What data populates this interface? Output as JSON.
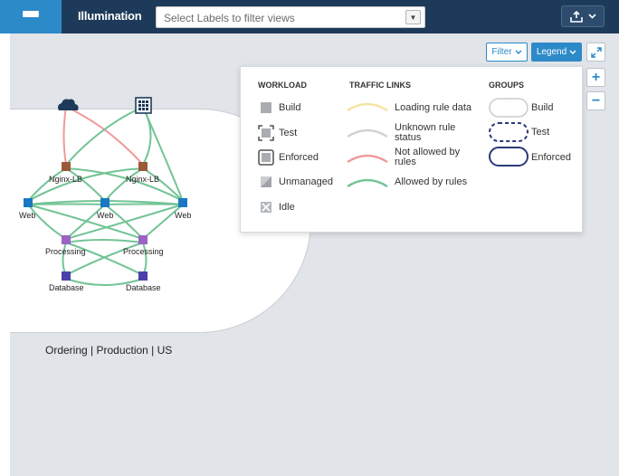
{
  "topbar": {
    "title": "Illumination",
    "label_filter_placeholder": "Select Labels to filter views",
    "menu_icon": "hamburger-icon",
    "export_icon": "upload-icon"
  },
  "toolbar": {
    "filter_label": "Filter",
    "legend_label": "Legend",
    "zoom_in": "+",
    "zoom_out": "−"
  },
  "colors": {
    "topbar": "#1e3a5a",
    "accent": "#2d8ac9",
    "canvas": "#e1e4e8",
    "allowed": "#72c496",
    "not_allowed": "#ef9a9a",
    "loading": "#f7e4a0",
    "unknown": "#cfd3d6",
    "lb": "#9a5a3a",
    "web": "#1a78c2",
    "processing": "#9b64c4",
    "database": "#4c3fa8"
  },
  "graph": {
    "group_label": "Ordering | Production | US",
    "nodes": [
      {
        "id": "cloud",
        "label": ""
      },
      {
        "id": "datacenter",
        "label": ""
      },
      {
        "id": "lb1",
        "label": "Nginx-LB"
      },
      {
        "id": "lb2",
        "label": "Nginx-LB"
      },
      {
        "id": "web1",
        "label": "Web"
      },
      {
        "id": "web2",
        "label": "Web"
      },
      {
        "id": "web3",
        "label": "Web"
      },
      {
        "id": "proc1",
        "label": "Processing"
      },
      {
        "id": "proc2",
        "label": "Processing"
      },
      {
        "id": "db1",
        "label": "Database"
      },
      {
        "id": "db2",
        "label": "Database"
      }
    ]
  },
  "legend": {
    "workload": {
      "heading": "WORKLOAD",
      "items": [
        "Build",
        "Test",
        "Enforced",
        "Unmanaged",
        "Idle"
      ]
    },
    "traffic": {
      "heading": "TRAFFIC LINKS",
      "items": [
        "Loading rule data",
        "Unknown rule status",
        "Not allowed by rules",
        "Allowed by rules"
      ]
    },
    "groups": {
      "heading": "GROUPS",
      "items": [
        "Build",
        "Test",
        "Enforced"
      ]
    }
  }
}
